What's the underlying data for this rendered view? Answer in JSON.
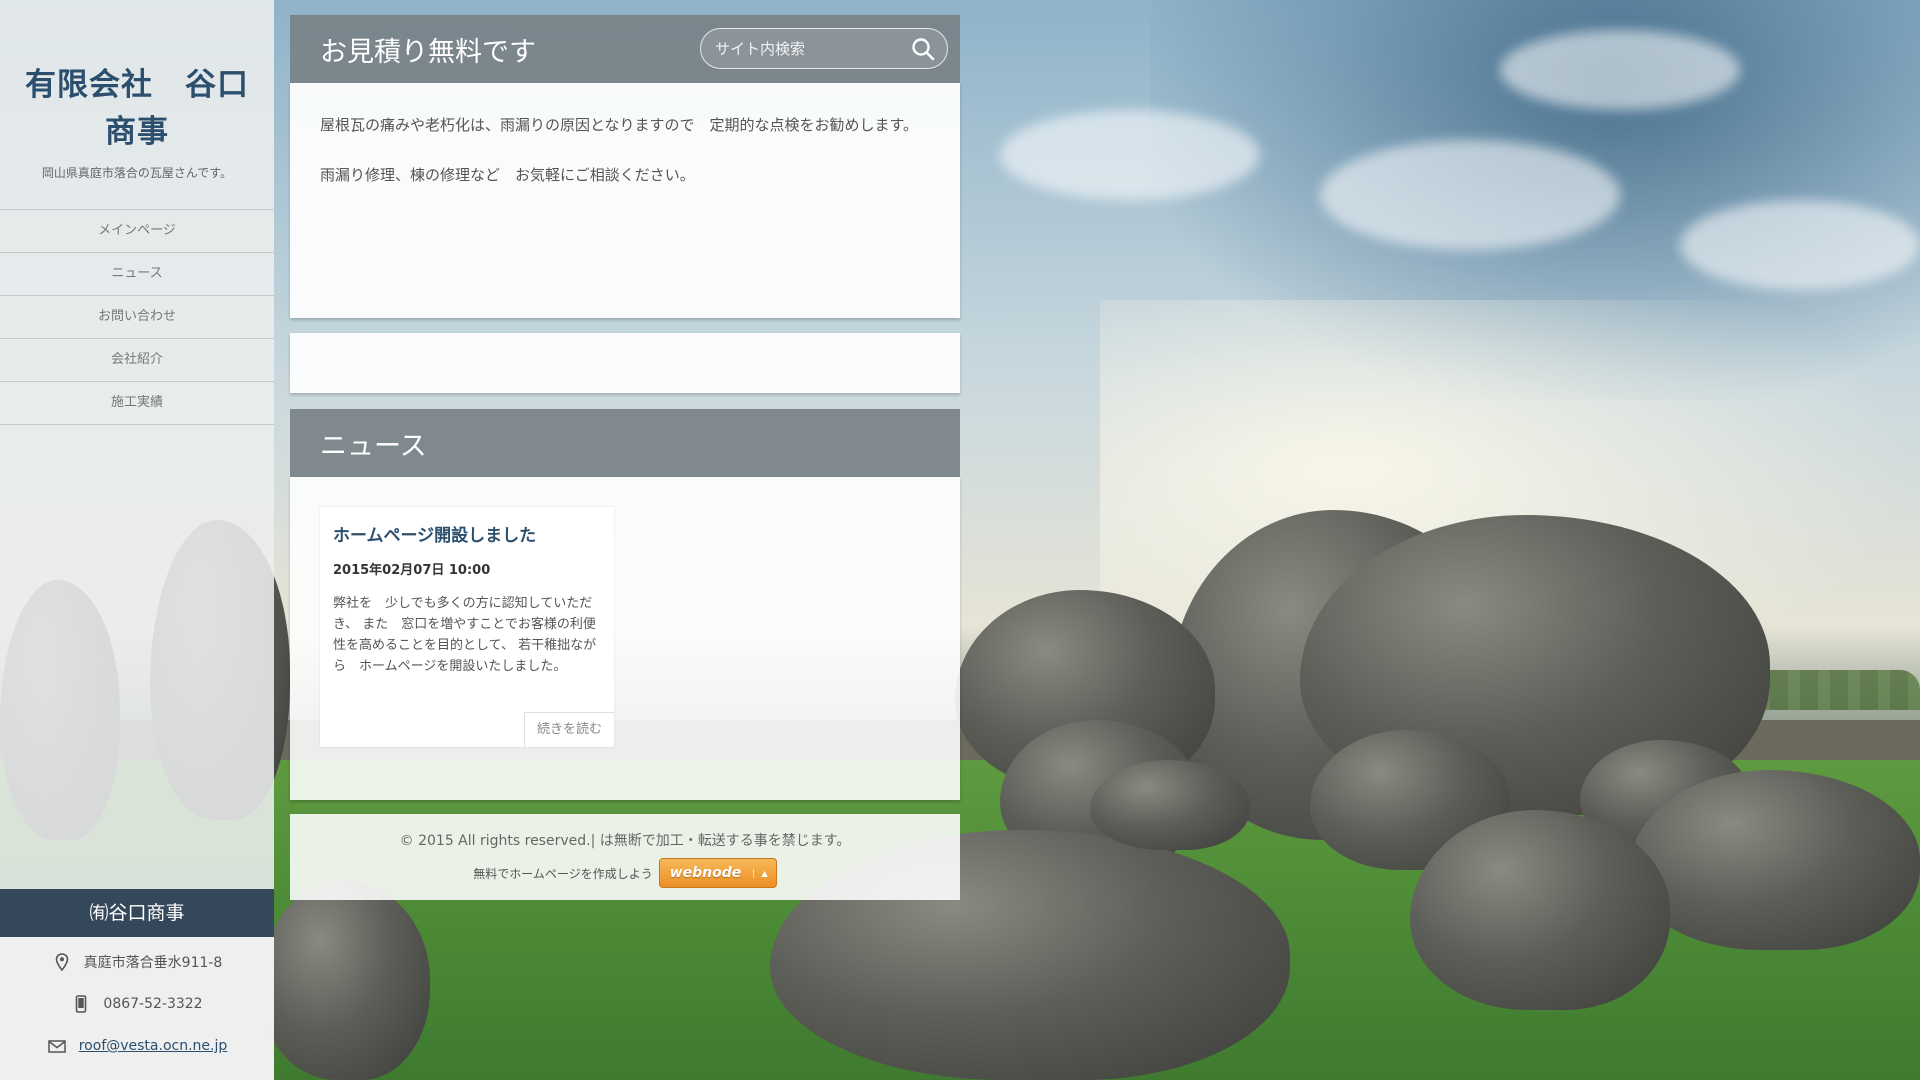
{
  "site": {
    "title": "有限会社　谷口商事",
    "subtitle": "岡山県真庭市落合の瓦屋さんです。"
  },
  "menu": {
    "items": [
      {
        "label": "メインページ"
      },
      {
        "label": "ニュース"
      },
      {
        "label": "お問い合わせ"
      },
      {
        "label": "会社紹介"
      },
      {
        "label": "施工実績"
      }
    ]
  },
  "contact": {
    "name": "㈲谷口商事",
    "address": "真庭市落合垂水911-8",
    "phone": "0867-52-3322",
    "email": "roof@vesta.ocn.ne.jp"
  },
  "intro": {
    "heading": "お見積り無料です",
    "search_placeholder": "サイト内検索",
    "paragraph1": "屋根瓦の痛みや老朽化は、雨漏りの原因となりますので　定期的な点検をお勧めします。",
    "paragraph2": "雨漏り修理、棟の修理など　お気軽にご相談ください。"
  },
  "news": {
    "heading": "ニュース",
    "item": {
      "title": "ホームページ開設しました",
      "date": "2015年02月07日 10:00",
      "text": "弊社を　少しでも多くの方に認知していただき、 また　窓口を増やすことでお客様の利便性を高めることを目的として、 若干稚拙ながら　ホームページを開設いたしました。",
      "read_more": "続きを読む"
    }
  },
  "footer": {
    "copyright": "© 2015 All rights reserved.| は無断で加工・転送する事を禁じます。",
    "make_site": "無料でホームページを作成しよう",
    "webnode_label": "webnode"
  },
  "icons": {
    "search": "search-icon",
    "location": "map-pin-icon",
    "phone": "mobile-phone-icon",
    "email": "mail-icon"
  }
}
